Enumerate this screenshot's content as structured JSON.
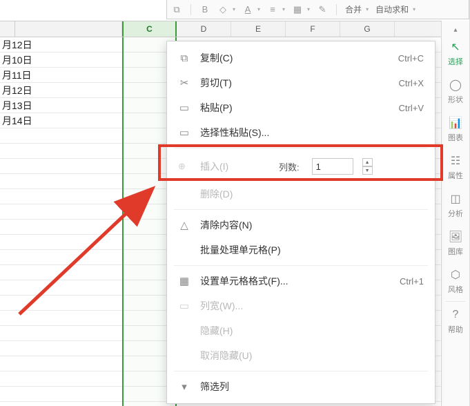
{
  "mini_toolbar": {
    "merge_label": "合并",
    "autosum_label": "自动求和"
  },
  "columns": [
    "C",
    "D",
    "E",
    "F",
    "G"
  ],
  "rows": [
    "月12日",
    "月10日",
    "月11日",
    "月12日",
    "月13日",
    "月14日"
  ],
  "ctx": {
    "copy": {
      "label": "复制(C)",
      "shortcut": "Ctrl+C"
    },
    "cut": {
      "label": "剪切(T)",
      "shortcut": "Ctrl+X"
    },
    "paste": {
      "label": "粘贴(P)",
      "shortcut": "Ctrl+V"
    },
    "paste_special": {
      "label": "选择性粘贴(S)..."
    },
    "insert": {
      "label": "插入(I)",
      "count_label": "列数:",
      "count_value": "1"
    },
    "delete": {
      "label": "删除(D)"
    },
    "clear": {
      "label": "清除内容(N)"
    },
    "batch": {
      "label": "批量处理单元格(P)"
    },
    "format": {
      "label": "设置单元格格式(F)...",
      "shortcut": "Ctrl+1"
    },
    "colwidth": {
      "label": "列宽(W)..."
    },
    "hide": {
      "label": "隐藏(H)"
    },
    "unhide": {
      "label": "取消隐藏(U)"
    },
    "filter": {
      "label": "筛选列"
    }
  },
  "side": {
    "select": "选择",
    "shape": "形状",
    "chart": "图表",
    "props": "属性",
    "analyze": "分析",
    "lib": "图库",
    "style": "风格",
    "help": "帮助"
  }
}
